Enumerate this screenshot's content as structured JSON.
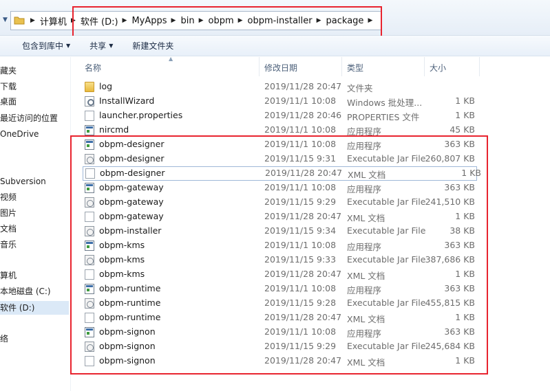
{
  "address": {
    "crumbs": [
      "计算机",
      "软件 (D:)",
      "MyApps",
      "bin",
      "obpm",
      "obpm-installer",
      "package"
    ]
  },
  "toolbar": {
    "include_library": "包含到库中",
    "share": "共享",
    "new_folder": "新建文件夹"
  },
  "sidebar": {
    "items": [
      "藏夹",
      "下载",
      "桌面",
      "最近访问的位置",
      "OneDrive",
      "Subversion",
      "视频",
      "图片",
      "文档",
      "音乐",
      "算机",
      "本地磁盘 (C:)",
      "软件 (D:)",
      "络"
    ]
  },
  "columns": {
    "name": "名称",
    "date": "修改日期",
    "type": "类型",
    "size": "大小"
  },
  "files": [
    {
      "name": "log",
      "date": "2019/11/28 20:47",
      "type": "文件夹",
      "size": "",
      "icon": "folder-icon"
    },
    {
      "name": "InstallWizard",
      "date": "2019/11/1 10:08",
      "type": "Windows 批处理...",
      "size": "1 KB",
      "icon": "batch-file-icon"
    },
    {
      "name": "launcher.properties",
      "date": "2019/11/28 20:46",
      "type": "PROPERTIES 文件",
      "size": "1 KB",
      "icon": "file-icon"
    },
    {
      "name": "nircmd",
      "date": "2019/11/1 10:08",
      "type": "应用程序",
      "size": "45 KB",
      "icon": "exe-icon"
    },
    {
      "name": "obpm-designer",
      "date": "2019/11/1 10:08",
      "type": "应用程序",
      "size": "363 KB",
      "icon": "exe-icon"
    },
    {
      "name": "obpm-designer",
      "date": "2019/11/15 9:31",
      "type": "Executable Jar File",
      "size": "260,807 KB",
      "icon": "jar-icon"
    },
    {
      "name": "obpm-designer",
      "date": "2019/11/28 20:47",
      "type": "XML 文档",
      "size": "1 KB",
      "icon": "file-icon"
    },
    {
      "name": "obpm-gateway",
      "date": "2019/11/1 10:08",
      "type": "应用程序",
      "size": "363 KB",
      "icon": "exe-icon"
    },
    {
      "name": "obpm-gateway",
      "date": "2019/11/15 9:29",
      "type": "Executable Jar File",
      "size": "241,510 KB",
      "icon": "jar-icon"
    },
    {
      "name": "obpm-gateway",
      "date": "2019/11/28 20:47",
      "type": "XML 文档",
      "size": "1 KB",
      "icon": "file-icon"
    },
    {
      "name": "obpm-installer",
      "date": "2019/11/15 9:34",
      "type": "Executable Jar File",
      "size": "38 KB",
      "icon": "jar-icon"
    },
    {
      "name": "obpm-kms",
      "date": "2019/11/1 10:08",
      "type": "应用程序",
      "size": "363 KB",
      "icon": "exe-icon"
    },
    {
      "name": "obpm-kms",
      "date": "2019/11/15 9:33",
      "type": "Executable Jar File",
      "size": "387,686 KB",
      "icon": "jar-icon"
    },
    {
      "name": "obpm-kms",
      "date": "2019/11/28 20:47",
      "type": "XML 文档",
      "size": "1 KB",
      "icon": "file-icon"
    },
    {
      "name": "obpm-runtime",
      "date": "2019/11/1 10:08",
      "type": "应用程序",
      "size": "363 KB",
      "icon": "exe-icon"
    },
    {
      "name": "obpm-runtime",
      "date": "2019/11/15 9:28",
      "type": "Executable Jar File",
      "size": "455,815 KB",
      "icon": "jar-icon"
    },
    {
      "name": "obpm-runtime",
      "date": "2019/11/28 20:47",
      "type": "XML 文档",
      "size": "1 KB",
      "icon": "file-icon"
    },
    {
      "name": "obpm-signon",
      "date": "2019/11/1 10:08",
      "type": "应用程序",
      "size": "363 KB",
      "icon": "exe-icon"
    },
    {
      "name": "obpm-signon",
      "date": "2019/11/15 9:29",
      "type": "Executable Jar File",
      "size": "245,684 KB",
      "icon": "jar-icon"
    },
    {
      "name": "obpm-signon",
      "date": "2019/11/28 20:47",
      "type": "XML 文档",
      "size": "1 KB",
      "icon": "file-icon"
    }
  ],
  "focused_row": 6,
  "colors": {
    "highlight": "#e8232e",
    "selection": "#dbe9f7"
  }
}
